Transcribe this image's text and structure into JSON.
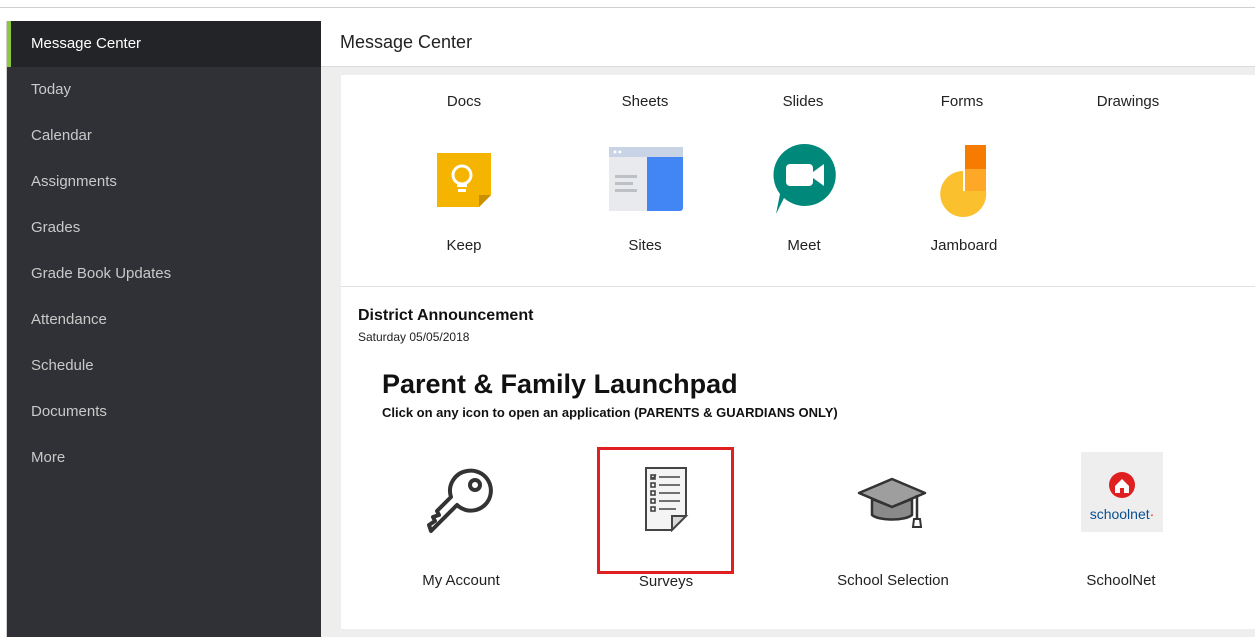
{
  "sidebar": {
    "items": [
      {
        "label": "Message Center",
        "active": true
      },
      {
        "label": "Today"
      },
      {
        "label": "Calendar"
      },
      {
        "label": "Assignments"
      },
      {
        "label": "Grades"
      },
      {
        "label": "Grade Book Updates"
      },
      {
        "label": "Attendance"
      },
      {
        "label": "Schedule"
      },
      {
        "label": "Documents"
      },
      {
        "label": "More"
      }
    ],
    "accent_color": "#8dc63f"
  },
  "header": {
    "title": "Message Center"
  },
  "apps_top_row": [
    {
      "label": "Docs"
    },
    {
      "label": "Sheets"
    },
    {
      "label": "Slides"
    },
    {
      "label": "Forms"
    },
    {
      "label": "Drawings"
    }
  ],
  "apps_icon_row": [
    {
      "label": "Keep",
      "icon": "keep-icon"
    },
    {
      "label": "Sites",
      "icon": "sites-icon"
    },
    {
      "label": "Meet",
      "icon": "meet-icon"
    },
    {
      "label": "Jamboard",
      "icon": "jamboard-icon"
    }
  ],
  "announcement": {
    "title": "District Announcement",
    "date": "Saturday 05/05/2018"
  },
  "launchpad": {
    "title": "Parent & Family Launchpad",
    "subtitle": "Click on any icon to open an application (PARENTS & GUARDIANS ONLY)",
    "items": [
      {
        "label": "My Account",
        "icon": "key-icon"
      },
      {
        "label": "Surveys",
        "icon": "survey-document-icon",
        "highlighted": true
      },
      {
        "label": "School Selection",
        "icon": "graduation-cap-icon"
      },
      {
        "label": "SchoolNet",
        "icon": "schoolnet-logo",
        "logo_text": "schoolnet"
      }
    ]
  },
  "colors": {
    "highlight": "#e02020",
    "keep": "#f4b400",
    "sites": "#4285f4",
    "meet": "#00897b",
    "jamboard_orange": "#f57c00",
    "jamboard_yellow": "#fbc02d"
  }
}
